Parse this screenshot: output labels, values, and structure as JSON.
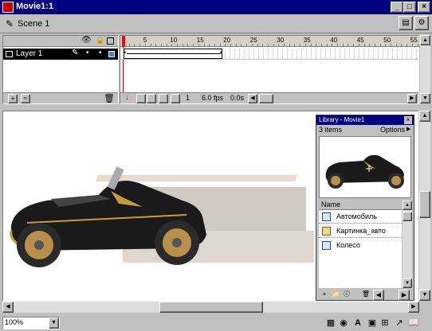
{
  "window": {
    "title": "Movie1:1",
    "minimize": "_",
    "maximize": "□",
    "close": "×"
  },
  "scene": {
    "label": "Scene 1"
  },
  "timeline": {
    "layer_name": "Layer 1",
    "ruler_labels": [
      "5",
      "10",
      "15",
      "20",
      "25",
      "30",
      "35",
      "40",
      "45",
      "50",
      "55"
    ],
    "current_frame": "1",
    "fps": "6.0 fps",
    "elapsed": "0.0s"
  },
  "library": {
    "title": "Library - Movie1",
    "count": "3 items",
    "options": "Options",
    "column_name": "Name",
    "items": [
      {
        "name": "Автомобиль",
        "icon": "movieclip-icon"
      },
      {
        "name": "Картинка_авто",
        "icon": "bitmap-icon"
      },
      {
        "name": "Колесо",
        "icon": "movieclip-icon"
      }
    ]
  },
  "status": {
    "zoom": "100%"
  }
}
